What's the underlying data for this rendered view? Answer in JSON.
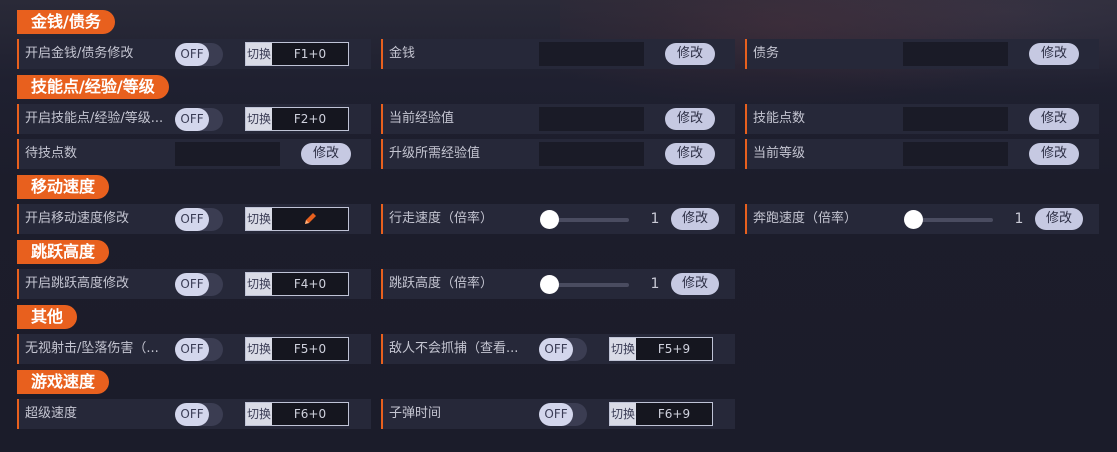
{
  "colors": {
    "accent": "#e8601e",
    "cell_bg": "#262839",
    "page_bg": "#1c1d2b",
    "toggle_knob": "#d3d6ec",
    "button": "#c6c9e2"
  },
  "labels": {
    "off": "OFF",
    "hotkey": "切换",
    "modify": "修改"
  },
  "sections": {
    "money": {
      "title": "金钱/债务",
      "toggle_label": "开启金钱/债务修改",
      "toggle_state": "OFF",
      "hotkey": "F1+0",
      "money_label": "金钱",
      "money_value": "",
      "debt_label": "债务",
      "debt_value": ""
    },
    "skills": {
      "title": "技能点/经验/等级",
      "toggle_label": "开启技能点/经验/等级...",
      "toggle_state": "OFF",
      "hotkey": "F2+0",
      "cur_exp_label": "当前经验值",
      "skill_points_label": "技能点数",
      "pending_points_label": "待技点数",
      "level_exp_label": "升级所需经验值",
      "cur_level_label": "当前等级"
    },
    "move": {
      "title": "移动速度",
      "toggle_label": "开启移动速度修改",
      "toggle_state": "OFF",
      "hotkey_icon": "pencil-icon",
      "walk_label": "行走速度（倍率）",
      "walk_value": "1",
      "run_label": "奔跑速度（倍率）",
      "run_value": "1"
    },
    "jump": {
      "title": "跳跃高度",
      "toggle_label": "开启跳跃高度修改",
      "toggle_state": "OFF",
      "hotkey": "F4+0",
      "height_label": "跳跃高度（倍率）",
      "height_value": "1"
    },
    "other": {
      "title": "其他",
      "ignore_label": "无视射击/坠落伤害（...",
      "ignore_state": "OFF",
      "ignore_hotkey": "F5+0",
      "enemy_label": "敌人不会抓捕（查看...",
      "enemy_state": "OFF",
      "enemy_hotkey": "F5+9"
    },
    "game_speed": {
      "title": "游戏速度",
      "super_label": "超级速度",
      "super_state": "OFF",
      "super_hotkey": "F6+0",
      "bullet_label": "子弹时间",
      "bullet_state": "OFF",
      "bullet_hotkey": "F6+9"
    }
  }
}
